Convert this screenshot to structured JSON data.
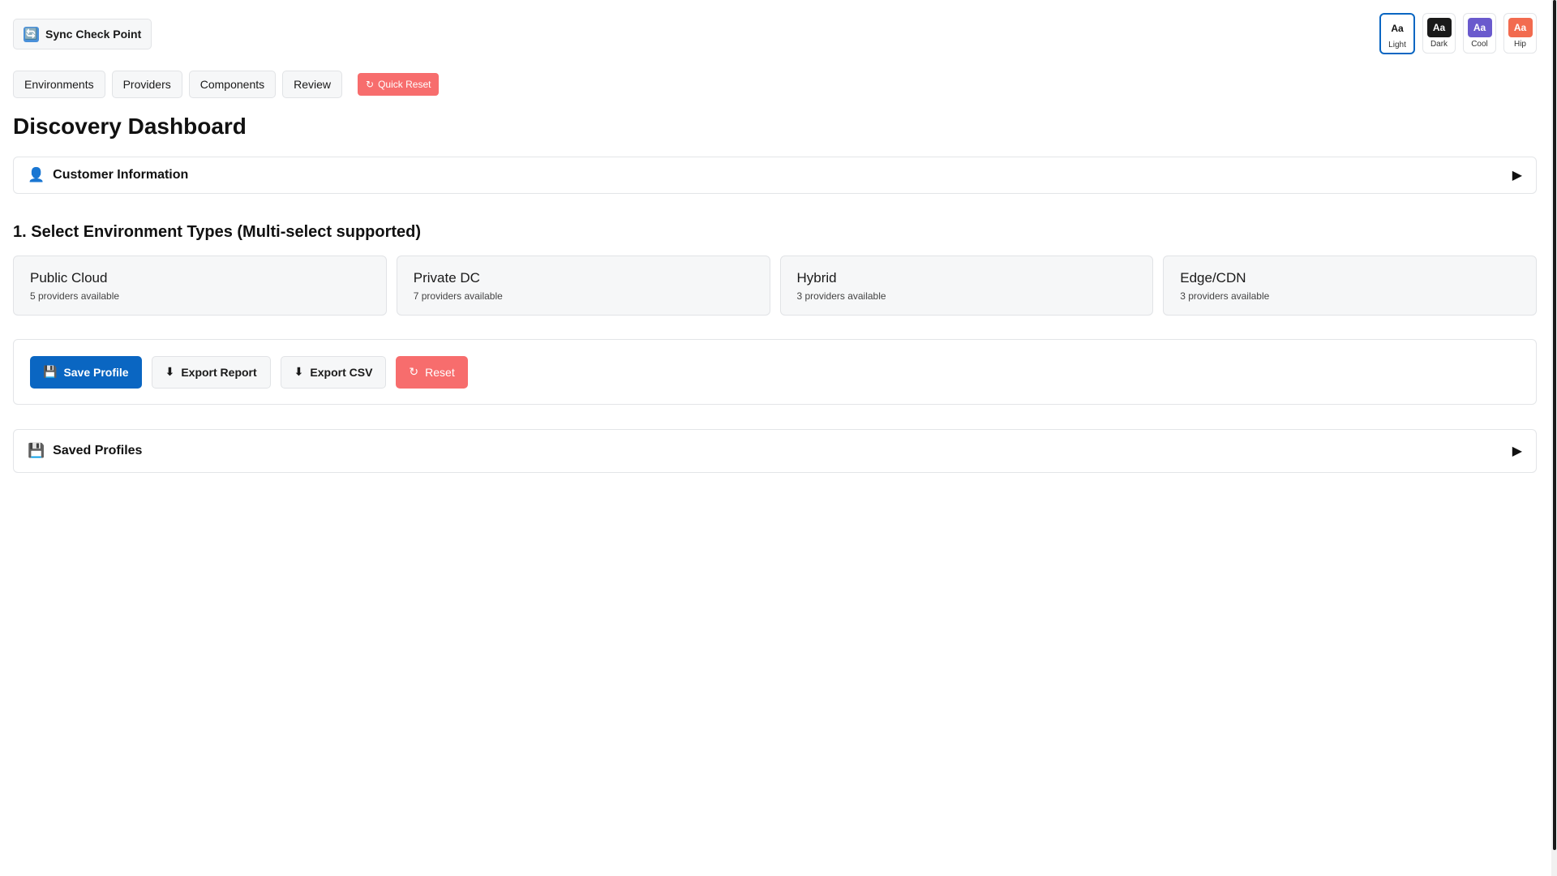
{
  "sync": {
    "icon": "🔄",
    "label": "Sync Check Point"
  },
  "themes": [
    {
      "swatch_text": "Aa",
      "label": "Light",
      "bg": "#ffffff",
      "fg": "#111111",
      "active": true
    },
    {
      "swatch_text": "Aa",
      "label": "Dark",
      "bg": "#1a1a1a",
      "fg": "#ffffff",
      "active": false
    },
    {
      "swatch_text": "Aa",
      "label": "Cool",
      "bg": "#6a5acd",
      "fg": "#ffffff",
      "active": false
    },
    {
      "swatch_text": "Aa",
      "label": "Hip",
      "bg": "#f26b4f",
      "fg": "#ffffff",
      "active": false
    }
  ],
  "tabs": [
    "Environments",
    "Providers",
    "Components",
    "Review"
  ],
  "quick_reset": {
    "icon": "↻",
    "label": "Quick Reset"
  },
  "page_title": "Discovery Dashboard",
  "customer_panel": {
    "icon": "👤",
    "title": "Customer Information",
    "arrow": "▶"
  },
  "env_section_title": "1. Select Environment Types (Multi-select supported)",
  "environments": [
    {
      "name": "Public Cloud",
      "sub": "5 providers available"
    },
    {
      "name": "Private DC",
      "sub": "7 providers available"
    },
    {
      "name": "Hybrid",
      "sub": "3 providers available"
    },
    {
      "name": "Edge/CDN",
      "sub": "3 providers available"
    }
  ],
  "actions": {
    "save": {
      "icon": "💾",
      "label": "Save Profile"
    },
    "export_report": {
      "icon": "⬇",
      "label": "Export Report"
    },
    "export_csv": {
      "icon": "⬇",
      "label": "Export CSV"
    },
    "reset": {
      "icon": "↻",
      "label": "Reset"
    }
  },
  "saved_panel": {
    "icon": "💾",
    "title": "Saved Profiles",
    "arrow": "▶"
  },
  "colors": {
    "accent": "#0a66c2",
    "danger": "#f76d6d"
  }
}
